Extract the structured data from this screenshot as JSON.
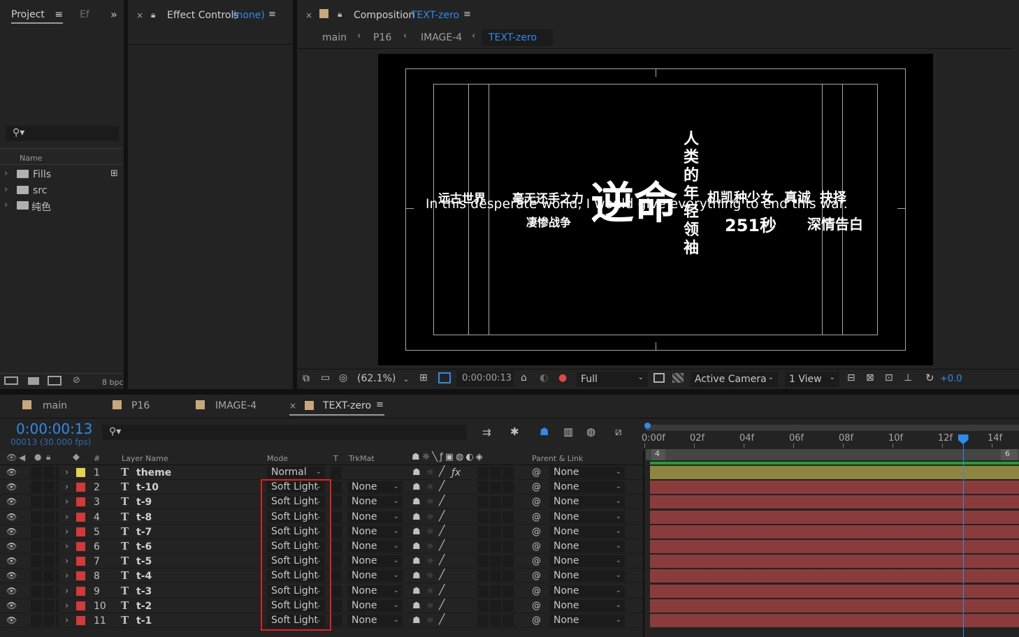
{
  "project_panel": {
    "tab_project": "Project",
    "tab_effects": "Ef",
    "more": "»",
    "column_name": "Name",
    "items": [
      {
        "label": "Fills"
      },
      {
        "label": "src"
      },
      {
        "label": "纯色"
      }
    ],
    "bpc": "8 bpc"
  },
  "effect_controls": {
    "title": "Effect Controls",
    "target": "(none)"
  },
  "composition": {
    "title": "Composition",
    "name": "TEXT-zero",
    "breadcrumbs": [
      "main",
      "P16",
      "IMAGE-4",
      "TEXT-zero"
    ],
    "viewer_text": {
      "left_top": "远古世界",
      "mid_top": "毫无还手之力",
      "main": "逆命",
      "vertical": "人类的年轻领袖",
      "right_top": "机凯种少女",
      "right_top2": "真诚",
      "right_top3": "抉择",
      "english": "In this desperate world, I would give everything to end this war.",
      "mid_bottom": "凄惨战争",
      "seconds": "251秒",
      "right_bottom": "深情告白"
    },
    "toolbar": {
      "zoom": "(62.1%)",
      "timecode": "0:00:00:13",
      "resolution": "Full",
      "camera": "Active Camera",
      "views": "1 View",
      "exposure": "+0.0"
    }
  },
  "timeline": {
    "tabs": [
      "main",
      "P16",
      "IMAGE-4",
      "TEXT-zero"
    ],
    "timecode": "0:00:00:13",
    "frames": "00013 (30.000 fps)",
    "columns": {
      "num": "#",
      "layer_name": "Layer Name",
      "mode": "Mode",
      "t": "T",
      "trkmat": "TrkMat",
      "parent": "Parent & Link"
    },
    "ruler": [
      "0:00f",
      "02f",
      "04f",
      "06f",
      "08f",
      "10f",
      "12f",
      "14f"
    ],
    "work_start": "4",
    "work_end": "6",
    "playhead_frame": 13,
    "layers": [
      {
        "num": "1",
        "name": "theme",
        "mode": "Normal",
        "trkmat": "",
        "parent": "None",
        "color": "#e3d24b"
      },
      {
        "num": "2",
        "name": "t-10",
        "mode": "Soft Light",
        "trkmat": "None",
        "parent": "None",
        "color": "#d23a3a"
      },
      {
        "num": "3",
        "name": "t-9",
        "mode": "Soft Light",
        "trkmat": "None",
        "parent": "None",
        "color": "#d23a3a"
      },
      {
        "num": "4",
        "name": "t-8",
        "mode": "Soft Light",
        "trkmat": "None",
        "parent": "None",
        "color": "#d23a3a"
      },
      {
        "num": "5",
        "name": "t-7",
        "mode": "Soft Light",
        "trkmat": "None",
        "parent": "None",
        "color": "#d23a3a"
      },
      {
        "num": "6",
        "name": "t-6",
        "mode": "Soft Light",
        "trkmat": "None",
        "parent": "None",
        "color": "#d23a3a"
      },
      {
        "num": "7",
        "name": "t-5",
        "mode": "Soft Light",
        "trkmat": "None",
        "parent": "None",
        "color": "#d23a3a"
      },
      {
        "num": "8",
        "name": "t-4",
        "mode": "Soft Light",
        "trkmat": "None",
        "parent": "None",
        "color": "#d23a3a"
      },
      {
        "num": "9",
        "name": "t-3",
        "mode": "Soft Light",
        "trkmat": "None",
        "parent": "None",
        "color": "#d23a3a"
      },
      {
        "num": "10",
        "name": "t-2",
        "mode": "Soft Light",
        "trkmat": "None",
        "parent": "None",
        "color": "#d23a3a"
      },
      {
        "num": "11",
        "name": "t-1",
        "mode": "Soft Light",
        "trkmat": "None",
        "parent": "None",
        "color": "#d23a3a"
      }
    ]
  },
  "colors": {
    "accent": "#2d8ceb",
    "highlight_box": "#e02020",
    "bar_theme": "#8f8540",
    "bar_text": "#8a3c3c"
  }
}
